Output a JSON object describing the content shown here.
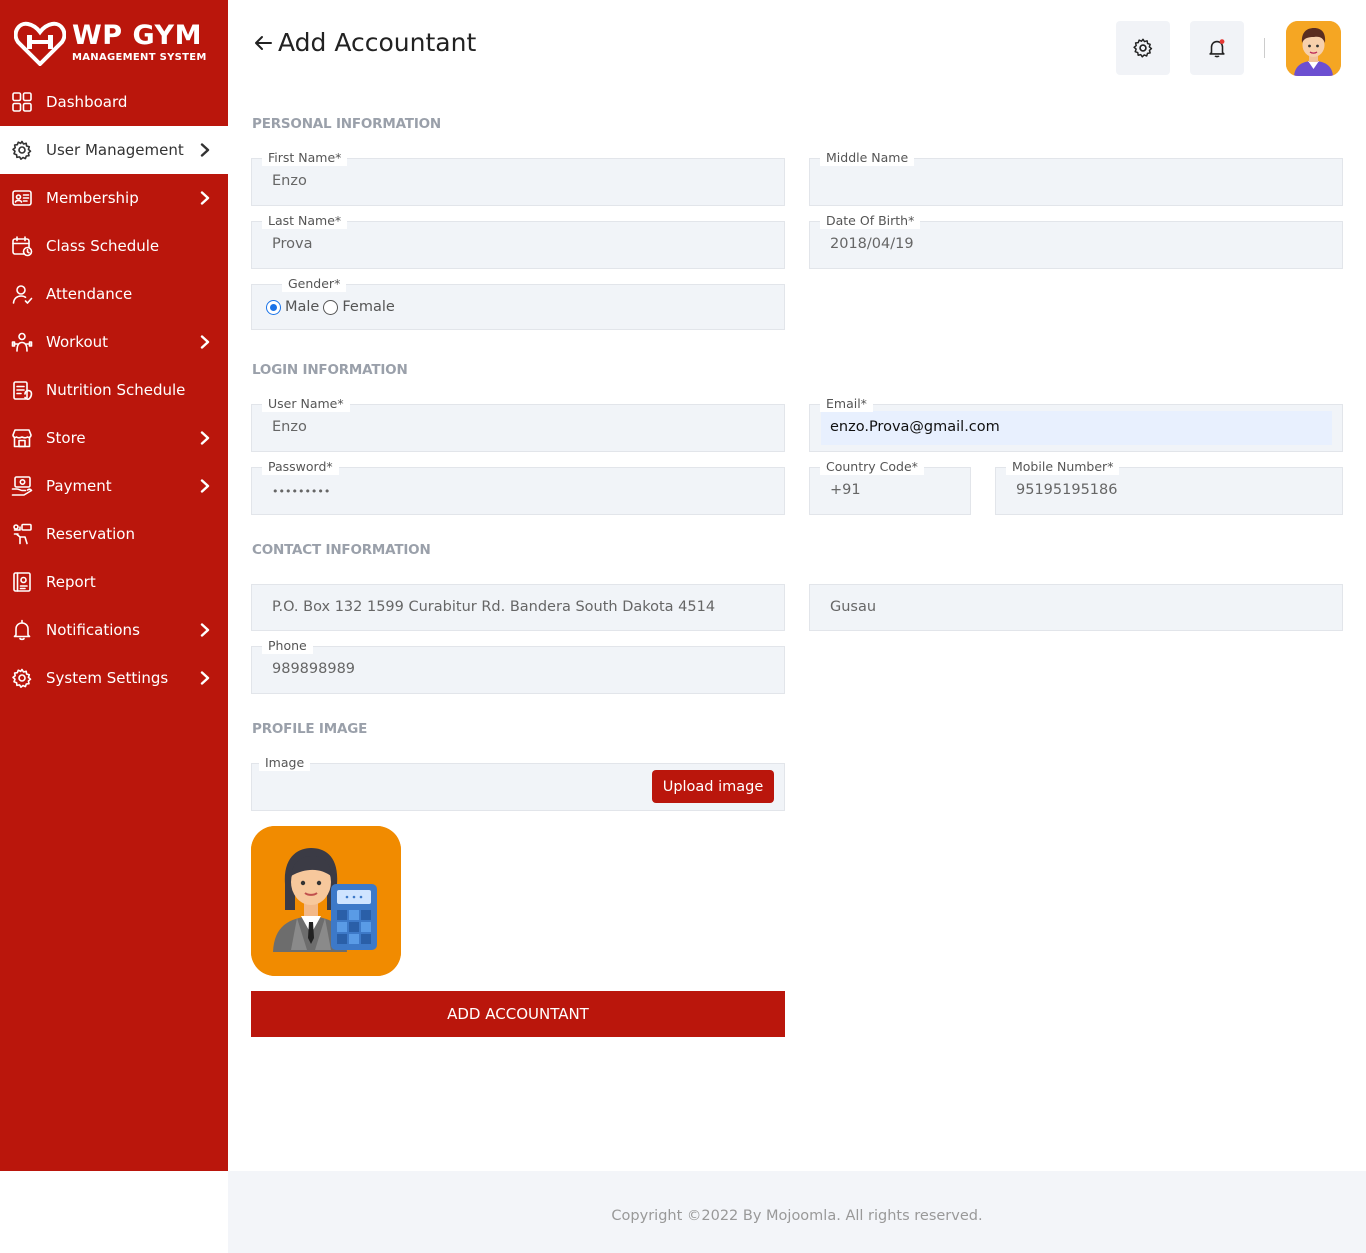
{
  "brand": {
    "title": "WP GYM",
    "subtitle": "MANAGEMENT SYSTEM"
  },
  "sidebar": {
    "items": [
      {
        "label": "Dashboard",
        "icon": "dashboard-icon",
        "chevron": false,
        "active": false
      },
      {
        "label": "User Management",
        "icon": "users-gear-icon",
        "chevron": true,
        "active": true
      },
      {
        "label": "Membership",
        "icon": "membership-card-icon",
        "chevron": true,
        "active": false
      },
      {
        "label": "Class Schedule",
        "icon": "calendar-icon",
        "chevron": false,
        "active": false
      },
      {
        "label": "Attendance",
        "icon": "user-check-icon",
        "chevron": false,
        "active": false
      },
      {
        "label": "Workout",
        "icon": "workout-icon",
        "chevron": true,
        "active": false
      },
      {
        "label": "Nutrition Schedule",
        "icon": "nutrition-icon",
        "chevron": false,
        "active": false
      },
      {
        "label": "Store",
        "icon": "store-icon",
        "chevron": true,
        "active": false
      },
      {
        "label": "Payment",
        "icon": "payment-icon",
        "chevron": true,
        "active": false
      },
      {
        "label": "Reservation",
        "icon": "reservation-icon",
        "chevron": false,
        "active": false
      },
      {
        "label": "Report",
        "icon": "report-icon",
        "chevron": false,
        "active": false
      },
      {
        "label": "Notifications",
        "icon": "bell-icon",
        "chevron": true,
        "active": false
      },
      {
        "label": "System Settings",
        "icon": "gear-icon",
        "chevron": true,
        "active": false
      }
    ]
  },
  "header": {
    "title": "Add Accountant"
  },
  "sections": {
    "personal": "PERSONAL INFORMATION",
    "login": "LOGIN INFORMATION",
    "contact": "CONTACT INFORMATION",
    "profile": "PROFILE IMAGE"
  },
  "form": {
    "first_name": {
      "label": "First Name*",
      "value": "Enzo"
    },
    "middle_name": {
      "label": "Middle Name",
      "value": ""
    },
    "last_name": {
      "label": "Last Name*",
      "value": "Prova"
    },
    "dob": {
      "label": "Date Of Birth*",
      "value": "2018/04/19"
    },
    "gender": {
      "label": "Gender*",
      "options": [
        "Male",
        "Female"
      ],
      "selected": "Male"
    },
    "username": {
      "label": "User Name*",
      "value": "Enzo"
    },
    "email": {
      "label": "Email*",
      "value": "enzo.Prova@gmail.com"
    },
    "password": {
      "label": "Password*",
      "value": "•••••••••"
    },
    "country_code": {
      "label": "Country Code*",
      "value": "+91"
    },
    "mobile": {
      "label": "Mobile Number*",
      "value": "95195195186"
    },
    "address": {
      "value": "P.O. Box 132 1599 Curabitur Rd. Bandera South Dakota 4514"
    },
    "city": {
      "value": "Gusau"
    },
    "phone": {
      "label": "Phone",
      "value": "989898989"
    },
    "image": {
      "label": "Image",
      "upload_label": "Upload image"
    },
    "submit_label": "ADD ACCOUNTANT"
  },
  "footer": {
    "text": "Copyright ©2022 By Mojoomla. All rights reserved."
  },
  "colors": {
    "brand_red": "#ba160c",
    "field_bg": "#f1f4f8",
    "accent_blue": "#1a73e8",
    "avatar_bg": "#f5a623",
    "profile_bg": "#f18b00"
  }
}
